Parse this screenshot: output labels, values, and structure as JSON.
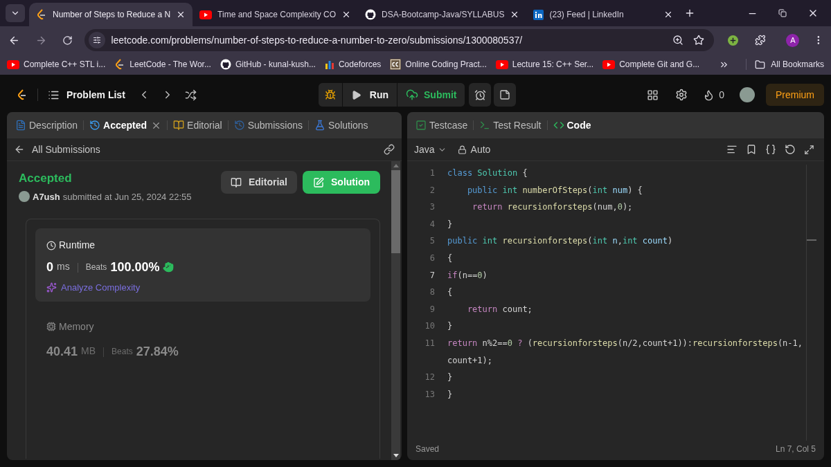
{
  "browser": {
    "tabs": [
      {
        "title": "Number of Steps to Reduce a N",
        "kind": "leetcode",
        "selected": true
      },
      {
        "title": "Time and Space Complexity CO",
        "kind": "youtube",
        "selected": false
      },
      {
        "title": "DSA-Bootcamp-Java/SYLLABUS",
        "kind": "github",
        "selected": false
      },
      {
        "title": "(23) Feed | LinkedIn",
        "kind": "linkedin",
        "selected": false
      }
    ],
    "url": "leetcode.com/problems/number-of-steps-to-reduce-a-number-to-zero/submissions/1300080537/",
    "bookmarks": [
      {
        "label": "Complete C++ STL i...",
        "kind": "youtube"
      },
      {
        "label": "LeetCode - The Wor...",
        "kind": "leetcode"
      },
      {
        "label": "GitHub - kunal-kush...",
        "kind": "github"
      },
      {
        "label": "Codeforces",
        "kind": "bars"
      },
      {
        "label": "Online Coding Pract...",
        "kind": "cc"
      },
      {
        "label": "Lecture 15: C++ Ser...",
        "kind": "youtube"
      },
      {
        "label": "Complete Git and G...",
        "kind": "youtube"
      }
    ],
    "all_bookmarks": "All Bookmarks",
    "profile_initial": "A"
  },
  "nav": {
    "problem_list": "Problem List",
    "run": "Run",
    "submit": "Submit",
    "streak": "0",
    "premium": "Premium"
  },
  "left_panel": {
    "tabs": [
      {
        "label": "Description",
        "kind": "doc",
        "selected": false,
        "closable": false
      },
      {
        "label": "Accepted",
        "kind": "history",
        "selected": true,
        "closable": true
      },
      {
        "label": "Editorial",
        "kind": "book",
        "selected": false,
        "closable": false
      },
      {
        "label": "Submissions",
        "kind": "history",
        "selected": false,
        "closable": false
      },
      {
        "label": "Solutions",
        "kind": "flask",
        "selected": false,
        "closable": false
      }
    ],
    "back": "All Submissions",
    "status": "Accepted",
    "user": "A7ush",
    "submitted": "submitted at Jun 25, 2024 22:55",
    "editorial_button": "Editorial",
    "solution_button": "Solution",
    "runtime": {
      "title": "Runtime",
      "value": "0",
      "unit": "ms",
      "beats_label": "Beats",
      "beats": "100.00%",
      "analyze": "Analyze Complexity"
    },
    "memory": {
      "title": "Memory",
      "value": "40.41",
      "unit": "MB",
      "beats_label": "Beats",
      "beats": "27.84%"
    }
  },
  "editor": {
    "tabs": [
      {
        "label": "Testcase",
        "kind": "check",
        "selected": false
      },
      {
        "label": "Test Result",
        "kind": "terminal",
        "selected": false
      },
      {
        "label": "Code",
        "kind": "code",
        "selected": true
      }
    ],
    "language": "Java",
    "mode": "Auto",
    "lines": [
      {
        "number": "1",
        "current": false,
        "rows": [
          [
            {
              "kind": "keyword",
              "text": "class"
            },
            {
              "kind": "type",
              "text": " Solution"
            },
            {
              "kind": "plain",
              "text": " {"
            }
          ]
        ]
      },
      {
        "number": "2",
        "current": false,
        "rows": [
          [
            {
              "kind": "keyword",
              "text": "    public "
            },
            {
              "kind": "type",
              "text": "int "
            },
            {
              "kind": "function",
              "text": "numberOfSteps"
            },
            {
              "kind": "plain",
              "text": "("
            },
            {
              "kind": "type",
              "text": "int "
            },
            {
              "kind": "variable",
              "text": "num"
            },
            {
              "kind": "plain",
              "text": ") {"
            }
          ]
        ]
      },
      {
        "number": "3",
        "current": false,
        "rows": [
          [
            {
              "kind": "control",
              "text": "     return "
            },
            {
              "kind": "function",
              "text": "recursionforsteps"
            },
            {
              "kind": "plain",
              "text": "(num,"
            },
            {
              "kind": "number",
              "text": "0"
            },
            {
              "kind": "plain",
              "text": ");"
            }
          ]
        ]
      },
      {
        "number": "4",
        "current": false,
        "rows": [
          [
            {
              "kind": "plain",
              "text": "}"
            }
          ]
        ]
      },
      {
        "number": "5",
        "current": false,
        "rows": [
          [
            {
              "kind": "keyword",
              "text": "public "
            },
            {
              "kind": "type",
              "text": "int "
            },
            {
              "kind": "function",
              "text": "recursionforsteps"
            },
            {
              "kind": "plain",
              "text": "("
            },
            {
              "kind": "type",
              "text": "int "
            },
            {
              "kind": "variable",
              "text": "n"
            },
            {
              "kind": "plain",
              "text": ","
            },
            {
              "kind": "type",
              "text": "int "
            },
            {
              "kind": "variable",
              "text": "count"
            },
            {
              "kind": "plain",
              "text": ")"
            }
          ]
        ]
      },
      {
        "number": "6",
        "current": false,
        "rows": [
          [
            {
              "kind": "plain",
              "text": "{"
            }
          ]
        ]
      },
      {
        "number": "7",
        "current": true,
        "rows": [
          [
            {
              "kind": "control",
              "text": "if"
            },
            {
              "kind": "plain",
              "text": "(n=="
            },
            {
              "kind": "number",
              "text": "0"
            },
            {
              "kind": "plain",
              "text": ")"
            }
          ]
        ]
      },
      {
        "number": "8",
        "current": false,
        "rows": [
          [
            {
              "kind": "plain",
              "text": "{"
            }
          ]
        ]
      },
      {
        "number": "9",
        "current": false,
        "rows": [
          [
            {
              "kind": "control",
              "text": "    return "
            },
            {
              "kind": "plain",
              "text": "count;"
            }
          ]
        ]
      },
      {
        "number": "10",
        "current": false,
        "rows": [
          [
            {
              "kind": "plain",
              "text": "}"
            }
          ]
        ]
      },
      {
        "number": "11",
        "current": false,
        "rows": [
          [
            {
              "kind": "control",
              "text": "return "
            },
            {
              "kind": "plain",
              "text": "n%2=="
            },
            {
              "kind": "number",
              "text": "0"
            },
            {
              "kind": "control",
              "text": " ? "
            },
            {
              "kind": "plain",
              "text": "("
            },
            {
              "kind": "function",
              "text": "recursionforsteps"
            },
            {
              "kind": "plain",
              "text": "(n/2,count+1)):"
            },
            {
              "kind": "function",
              "text": "recursionforsteps"
            },
            {
              "kind": "plain",
              "text": "(n-1,"
            }
          ],
          [
            {
              "kind": "plain",
              "text": "count+1);"
            }
          ]
        ]
      },
      {
        "number": "12",
        "current": false,
        "rows": [
          [
            {
              "kind": "plain",
              "text": "}"
            }
          ]
        ]
      },
      {
        "number": "13",
        "current": false,
        "rows": [
          [
            {
              "kind": "plain",
              "text": "}"
            }
          ]
        ]
      }
    ],
    "status": "Saved",
    "cursor": "Ln 7, Col 5"
  }
}
